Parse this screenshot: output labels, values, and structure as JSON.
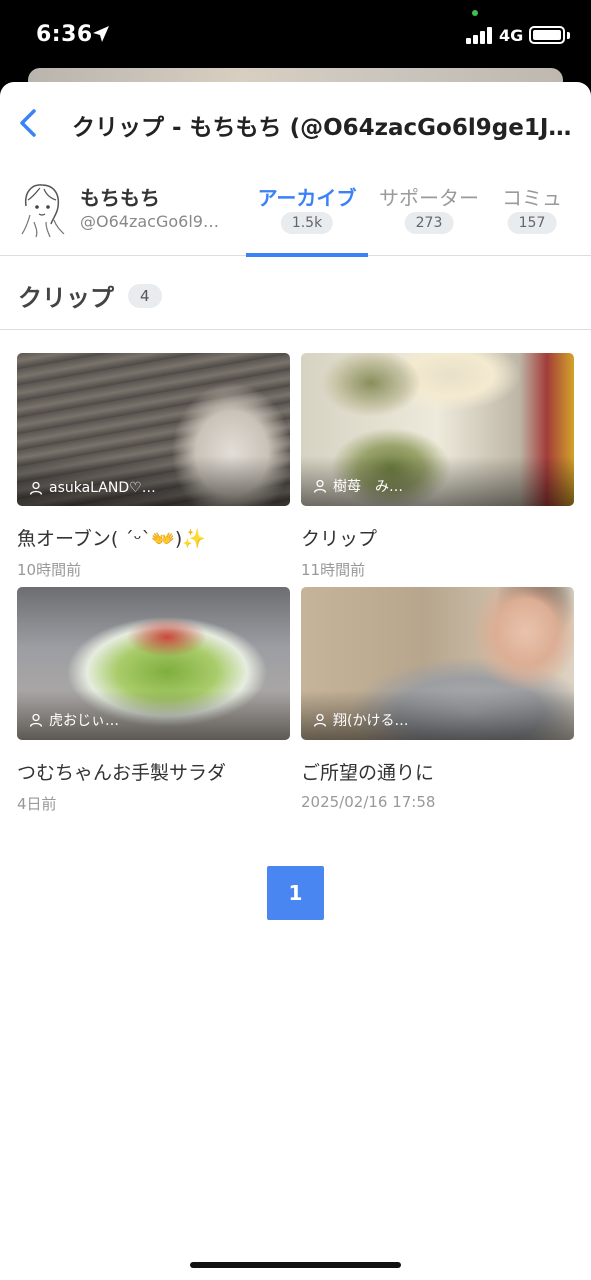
{
  "status_bar": {
    "time": "6:36",
    "network": "4G",
    "icons": [
      "location-arrow-icon",
      "signal-bars-icon",
      "battery-icon"
    ]
  },
  "nav": {
    "title": "クリップ - もちもち (@O64zacGo6l9ge1J) -..."
  },
  "profile": {
    "name": "もちもち",
    "handle": "@O64zacGo6l9…"
  },
  "tabs": [
    {
      "label": "アーカイブ",
      "count": "1.5k",
      "active": true
    },
    {
      "label": "サポーター",
      "count": "273",
      "active": false
    },
    {
      "label": "コミュ",
      "count": "157",
      "active": false
    }
  ],
  "section": {
    "title": "クリップ",
    "count": "4"
  },
  "clips": [
    {
      "user": "asukaLAND♡…",
      "title": "魚オーブン( ´ᵕ`👐)✨",
      "time": "10時間前"
    },
    {
      "user": "樹苺　み…",
      "title": "クリップ",
      "time": "11時間前"
    },
    {
      "user": "虎おじぃ…",
      "title": "つむちゃんお手製サラダ",
      "time": "4日前"
    },
    {
      "user": "翔(かける…",
      "title": "ご所望の通りに",
      "time": "2025/02/16 17:58"
    }
  ],
  "pagination": {
    "current": "1"
  },
  "colors": {
    "accent": "#3b82f6",
    "page_button": "#4a86f2"
  }
}
